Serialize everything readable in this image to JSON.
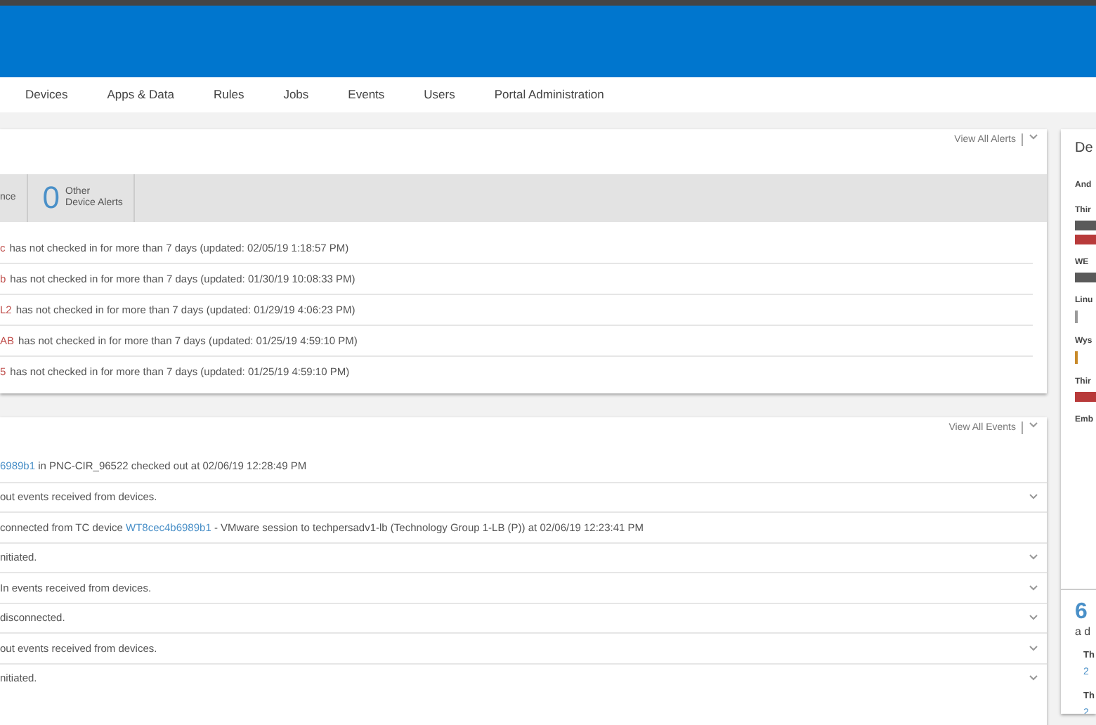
{
  "nav": {
    "items": [
      {
        "label": "Devices",
        "selected": false
      },
      {
        "label": "Apps & Data",
        "selected": false
      },
      {
        "label": "Rules",
        "selected": false
      },
      {
        "label": "Jobs",
        "selected": false
      },
      {
        "label": "Events",
        "selected": false
      },
      {
        "label": "Users",
        "selected": false
      },
      {
        "label": "Portal Administration",
        "selected": false
      }
    ]
  },
  "alerts": {
    "view_all": "View All Alerts",
    "summary": [
      {
        "label": "nce"
      },
      {
        "count": "0",
        "label": "Other\nDevice Alerts"
      }
    ],
    "rows": [
      {
        "device": "c",
        "message": "has not checked in for more than 7 days (updated: 02/05/19 1:18:57 PM)"
      },
      {
        "device": "b",
        "message": "has not checked in for more than 7 days (updated: 01/30/19 10:08:33 PM)"
      },
      {
        "device": "L2",
        "message": "has not checked in for more than 7 days (updated: 01/29/19 4:06:23 PM)"
      },
      {
        "device": "AB",
        "message": "has not checked in for more than 7 days (updated: 01/25/19 4:59:10 PM)"
      },
      {
        "device": "5",
        "message": "has not checked in for more than 7 days (updated: 01/25/19 4:59:10 PM)"
      }
    ]
  },
  "events": {
    "view_all": "View All Events",
    "rows": [
      {
        "expandable": false,
        "parts": [
          {
            "text": "6989b1",
            "link": true
          },
          {
            "text": " in PNC-CIR_96522 checked out at 02/06/19 12:28:49 PM",
            "link": false
          }
        ]
      },
      {
        "expandable": true,
        "parts": [
          {
            "text": "out events received from devices.",
            "link": false
          }
        ]
      },
      {
        "expandable": false,
        "parts": [
          {
            "text": "connected from TC device ",
            "link": false
          },
          {
            "text": "WT8cec4b6989b1",
            "link": true
          },
          {
            "text": " - VMware session to techpersadv1-lb (Technology Group 1-LB (P)) at 02/06/19 12:23:41 PM",
            "link": false
          }
        ]
      },
      {
        "expandable": true,
        "parts": [
          {
            "text": "nitiated.",
            "link": false
          }
        ]
      },
      {
        "expandable": true,
        "parts": [
          {
            "text": "In events received from devices.",
            "link": false
          }
        ]
      },
      {
        "expandable": true,
        "parts": [
          {
            "text": "disconnected.",
            "link": false
          }
        ]
      },
      {
        "expandable": true,
        "parts": [
          {
            "text": "out events received from devices.",
            "link": false
          }
        ]
      },
      {
        "expandable": true,
        "parts": [
          {
            "text": "nitiated.",
            "link": false
          }
        ]
      }
    ]
  },
  "side": {
    "title": "De",
    "items": [
      {
        "label": "And"
      },
      {
        "label": "Thir",
        "bars": [
          {
            "color": "#5a5a5a"
          },
          {
            "color": "#b83a3a"
          }
        ]
      },
      {
        "label": "WE",
        "bars": [
          {
            "color": "#5a5a5a"
          }
        ]
      },
      {
        "label": "Linu",
        "bars": [
          {
            "color": "#9a9a9a"
          }
        ]
      },
      {
        "label": "Wys",
        "bars": [
          {
            "color": "#c88a2a"
          }
        ]
      },
      {
        "label": "Thir",
        "bars": [
          {
            "color": "#b83a3a"
          }
        ]
      },
      {
        "label": "Emb"
      }
    ],
    "count": "6",
    "count_label": "a d",
    "groups": [
      {
        "label": "Th",
        "value": "2"
      },
      {
        "label": "Th",
        "value": "2"
      }
    ]
  }
}
